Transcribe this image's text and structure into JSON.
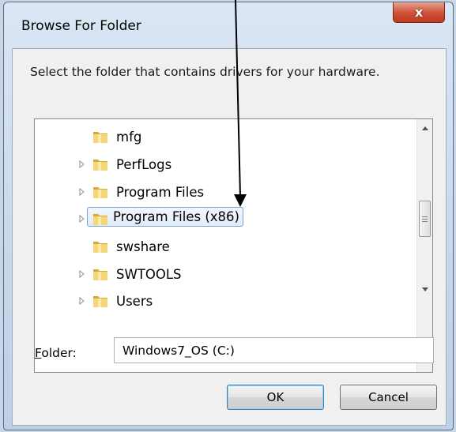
{
  "window": {
    "title": "Browse For Folder",
    "close_glyph": "x"
  },
  "instruction": "Select the folder that contains drivers for your hardware.",
  "tree": {
    "items": [
      {
        "label": "mfg",
        "has_expander": false
      },
      {
        "label": "PerfLogs",
        "has_expander": true
      },
      {
        "label": "Program Files",
        "has_expander": true
      },
      {
        "label": "Program Files (x86)",
        "has_expander": true,
        "selected": true
      },
      {
        "label": "swshare",
        "has_expander": false
      },
      {
        "label": "SWTOOLS",
        "has_expander": true
      },
      {
        "label": "Users",
        "has_expander": true
      }
    ]
  },
  "folder": {
    "label_prefix": "F",
    "label_rest": "older:",
    "value": "Windows7_OS (C:)"
  },
  "buttons": {
    "ok": "OK",
    "cancel": "Cancel"
  },
  "colors": {
    "close_red": "#c0391f",
    "folder_yellow": "#e8c25a",
    "selection_border": "#7da2ce"
  }
}
